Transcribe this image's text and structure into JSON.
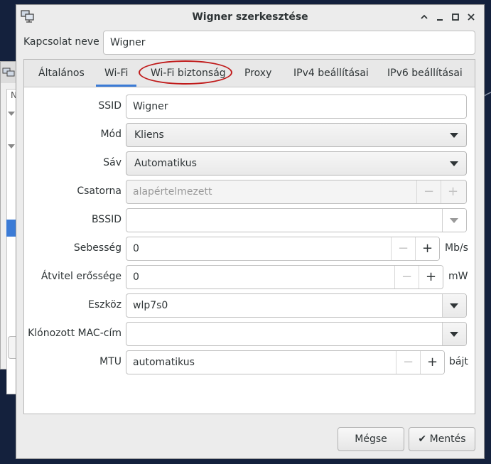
{
  "dialog": {
    "title": "Wigner szerkesztése",
    "connection_name_label": "Kapcsolat neve",
    "connection_name_value": "Wigner"
  },
  "tabs": [
    {
      "label": "Általános"
    },
    {
      "label": "Wi-Fi"
    },
    {
      "label": "Wi-Fi biztonság"
    },
    {
      "label": "Proxy"
    },
    {
      "label": "IPv4 beállításai"
    },
    {
      "label": "IPv6 beállításai"
    }
  ],
  "active_tab": "Wi-Fi",
  "highlighted_tab": "Wi-Fi biztonság",
  "wifi": {
    "ssid_label": "SSID",
    "ssid_value": "Wigner",
    "mode_label": "Mód",
    "mode_value": "Kliens",
    "band_label": "Sáv",
    "band_value": "Automatikus",
    "channel_label": "Csatorna",
    "channel_placeholder": "alapértelmezett",
    "bssid_label": "BSSID",
    "bssid_value": "",
    "rate_label": "Sebesség",
    "rate_value": "0",
    "rate_unit": "Mb/s",
    "tx_power_label": "Átvitel erőssége",
    "tx_power_value": "0",
    "tx_power_unit": "mW",
    "device_label": "Eszköz",
    "device_value": "wlp7s0",
    "cloned_mac_label": "Klónozott MAC-cím",
    "cloned_mac_value": "",
    "mtu_label": "MTU",
    "mtu_value": "automatikus",
    "mtu_unit": "bájt"
  },
  "buttons": {
    "cancel": "Mégse",
    "save": "Mentés"
  },
  "spin": {
    "minus": "−",
    "plus": "+"
  },
  "background_window": {
    "header_fragment": "N"
  },
  "colors": {
    "accent": "#3b7bd6",
    "highlight_ring": "#c01a1a",
    "desktop": "#14213d"
  }
}
